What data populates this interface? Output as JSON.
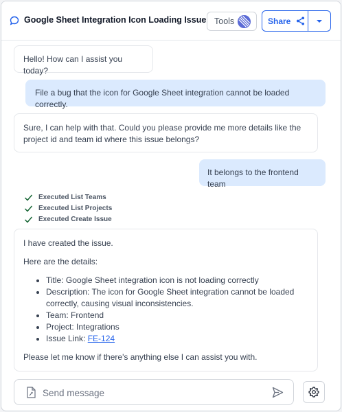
{
  "header": {
    "title": "Google Sheet Integration Icon Loading Issue",
    "tools_label": "Tools",
    "share_label": "Share",
    "icons": {
      "chat": "chat-bubble-icon",
      "share": "share-icon",
      "dropdown": "chevron-down-icon",
      "tools_logo": "tools-logo-icon"
    }
  },
  "colors": {
    "accent": "#2563eb",
    "user_bubble": "#dbeafe",
    "check": "#166534"
  },
  "messages": [
    {
      "role": "assistant",
      "text": "Hello! How can I assist you today?"
    },
    {
      "role": "user",
      "text": "File a bug that the icon for Google Sheet integration cannot be loaded correctly."
    },
    {
      "role": "assistant",
      "text": "Sure, I can help with that. Could you please provide me more details like the project id and team id where this issue belongs?"
    },
    {
      "role": "user",
      "text": "It belongs to the frontend team"
    }
  ],
  "executed_steps": [
    "Executed List Teams",
    "Executed List Projects",
    "Executed Create Issue"
  ],
  "final_message": {
    "intro": "I have created the issue.",
    "details_heading": "Here are the details:",
    "items": [
      "Title: Google Sheet integration icon is not loading correctly",
      "Description: The icon for Google Sheet integration cannot be loaded correctly, causing visual inconsistencies.",
      "Team: Frontend",
      "Project: Integrations"
    ],
    "issue_link_label": "Issue Link: ",
    "issue_link_text": "FE-124",
    "closing": "Please let me know if there's anything else I can assist you with."
  },
  "composer": {
    "placeholder": "Send message",
    "value": "",
    "icons": {
      "attach": "attach-file-icon",
      "send": "send-icon",
      "settings": "settings-gear-icon"
    }
  }
}
